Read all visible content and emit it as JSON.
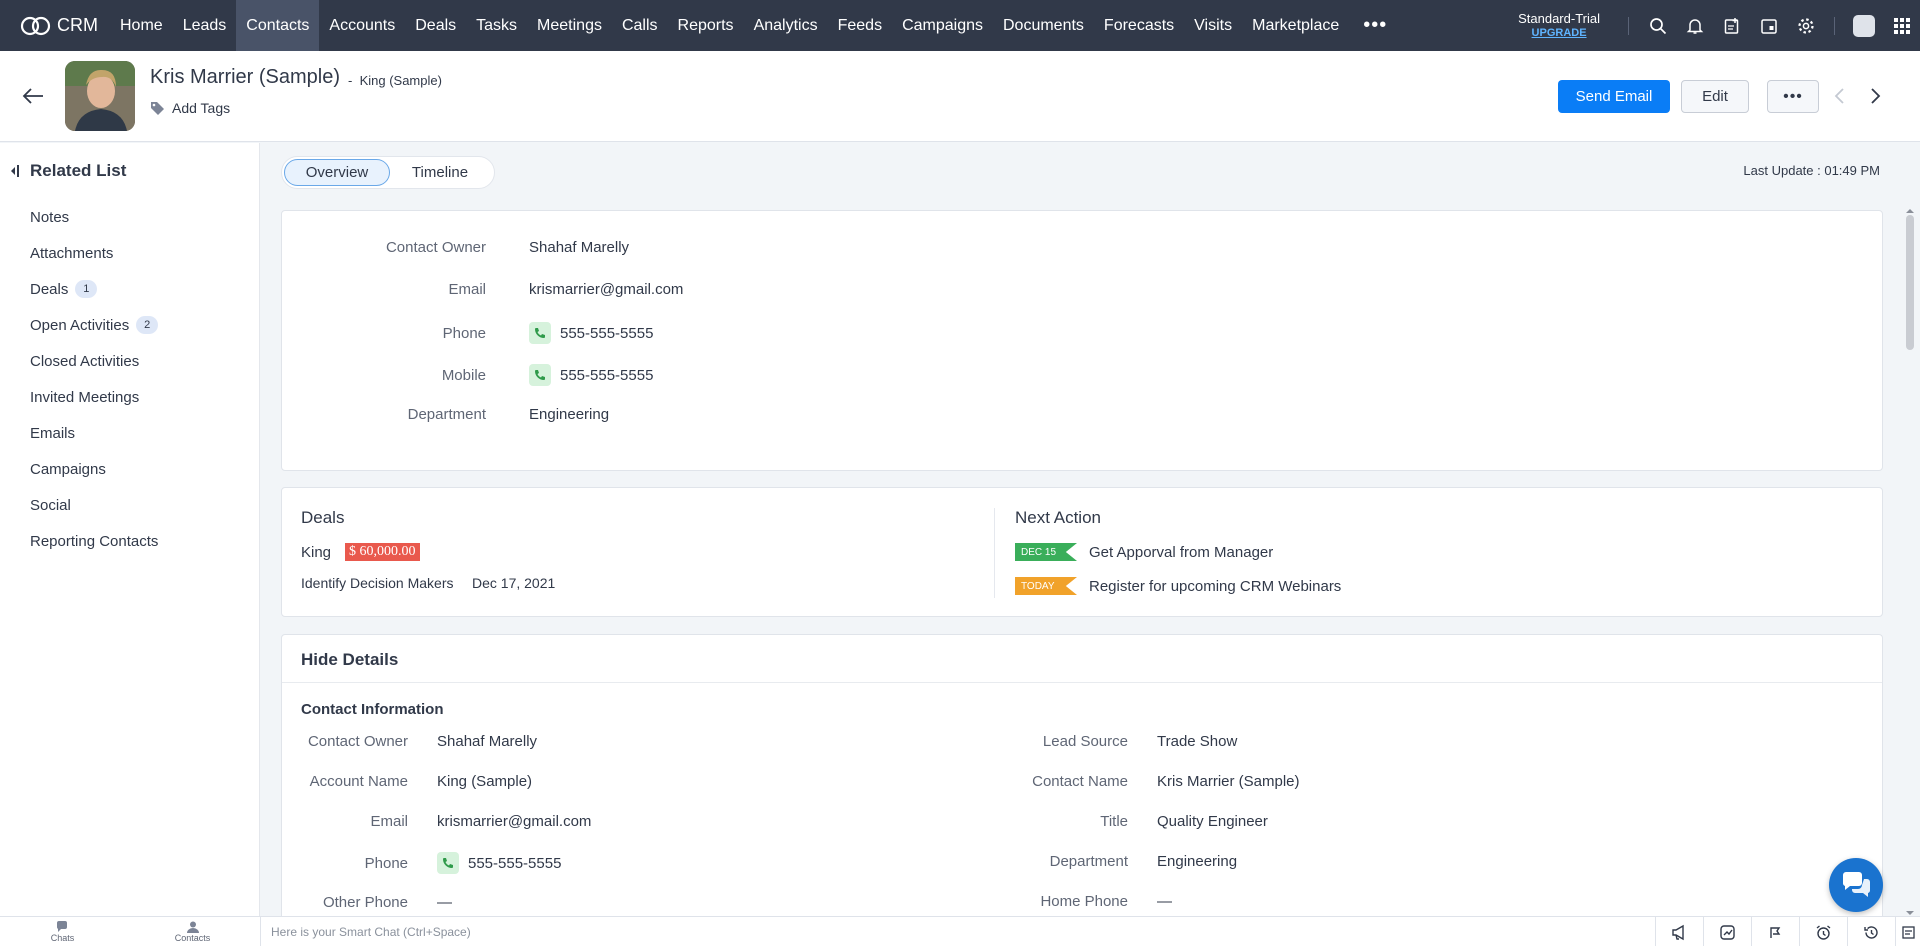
{
  "app": {
    "name": "CRM",
    "nav_tabs": [
      "Home",
      "Leads",
      "Contacts",
      "Accounts",
      "Deals",
      "Tasks",
      "Meetings",
      "Calls",
      "Reports",
      "Analytics",
      "Feeds",
      "Campaigns",
      "Documents",
      "Forecasts",
      "Visits",
      "Marketplace"
    ],
    "active_tab": "Contacts",
    "more": "•••",
    "plan": "Standard-Trial",
    "upgrade": "UPGRADE",
    "icons": [
      "search-icon",
      "bell-icon",
      "add-record-icon",
      "calendar-icon",
      "gear-icon",
      "apps-grid-icon"
    ]
  },
  "record": {
    "name": "Kris Marrier (Sample)",
    "account_sub": "King (Sample)",
    "add_tags": "Add Tags",
    "send_email": "Send Email",
    "edit": "Edit",
    "more": "•••"
  },
  "sidebar": {
    "title": "Related List",
    "items": [
      {
        "label": "Notes",
        "count": ""
      },
      {
        "label": "Attachments",
        "count": ""
      },
      {
        "label": "Deals",
        "count": "1"
      },
      {
        "label": "Open Activities",
        "count": "2"
      },
      {
        "label": "Closed Activities",
        "count": ""
      },
      {
        "label": "Invited Meetings",
        "count": ""
      },
      {
        "label": "Emails",
        "count": ""
      },
      {
        "label": "Campaigns",
        "count": ""
      },
      {
        "label": "Social",
        "count": ""
      },
      {
        "label": "Reporting Contacts",
        "count": ""
      }
    ]
  },
  "view_tabs": {
    "overview": "Overview",
    "timeline": "Timeline"
  },
  "last_update": "Last Update : 01:49 PM",
  "summary": [
    {
      "label": "Contact Owner",
      "value": "Shahaf Marelly"
    },
    {
      "label": "Email",
      "value": "krismarrier@gmail.com"
    },
    {
      "label": "Phone",
      "value": "555-555-5555"
    },
    {
      "label": "Mobile",
      "value": "555-555-5555"
    },
    {
      "label": "Department",
      "value": "Engineering"
    }
  ],
  "deals": {
    "title": "Deals",
    "name": "King",
    "amount": "$ 60,000.00",
    "stage": "Identify Decision Makers",
    "date": "Dec 17, 2021"
  },
  "next_action": {
    "title": "Next Action",
    "items": [
      {
        "flag": "DEC 15",
        "text": "Get Apporval from Manager",
        "color": "#3aae5a"
      },
      {
        "flag": "TODAY",
        "text": "Register for upcoming CRM Webinars",
        "color": "#f1a22a"
      }
    ]
  },
  "details": {
    "toggle": "Hide Details",
    "section": "Contact Information",
    "left": [
      {
        "label": "Contact Owner",
        "value": "Shahaf Marelly"
      },
      {
        "label": "Account Name",
        "value": "King (Sample)"
      },
      {
        "label": "Email",
        "value": "krismarrier@gmail.com"
      },
      {
        "label": "Phone",
        "value": "555-555-5555"
      },
      {
        "label": "Other Phone",
        "value": "—"
      }
    ],
    "right": [
      {
        "label": "Lead Source",
        "value": "Trade Show"
      },
      {
        "label": "Contact Name",
        "value": "Kris Marrier (Sample)"
      },
      {
        "label": "Title",
        "value": "Quality Engineer"
      },
      {
        "label": "Department",
        "value": "Engineering"
      },
      {
        "label": "Home Phone",
        "value": "—"
      }
    ]
  },
  "bottom": {
    "chats": "Chats",
    "contacts": "Contacts",
    "smart_chat_placeholder": "Here is your Smart Chat (Ctrl+Space)"
  },
  "colors": {
    "nav_bg": "#313949",
    "primary": "#0a7df6",
    "deal_amount": "#e9594d",
    "link": "#2b76cf"
  }
}
